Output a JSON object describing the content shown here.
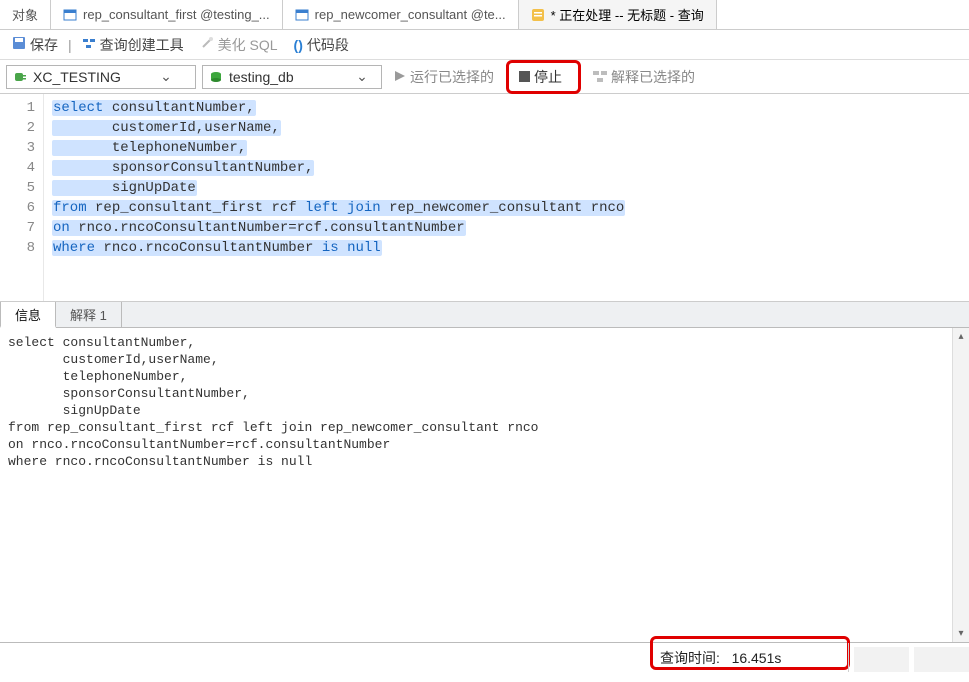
{
  "tabs": [
    {
      "label": "对象",
      "icon": ""
    },
    {
      "label": "rep_consultant_first @testing_...",
      "icon": "table"
    },
    {
      "label": "rep_newcomer_consultant @te...",
      "icon": "table"
    },
    {
      "label": "* 正在处理 -- 无标题 - 查询",
      "icon": "query",
      "active": true
    }
  ],
  "toolbar": {
    "save": "保存",
    "querybuilder": "查询创建工具",
    "beautify": "美化 SQL",
    "snippet": "代码段"
  },
  "controls": {
    "connection": "XC_TESTING",
    "database": "testing_db",
    "run": "运行已选择的",
    "stop": "停止",
    "explain": "解释已选择的"
  },
  "editor_lines": [
    {
      "n": "1",
      "pre": "",
      "kw": "select",
      "post": " consultantNumber,"
    },
    {
      "n": "2",
      "pre": "       ",
      "kw": "",
      "post": "customerId,userName,"
    },
    {
      "n": "3",
      "pre": "       ",
      "kw": "",
      "post": "telephoneNumber,"
    },
    {
      "n": "4",
      "pre": "       ",
      "kw": "",
      "post": "sponsorConsultantNumber,"
    },
    {
      "n": "5",
      "pre": "       ",
      "kw": "",
      "post": "signUpDate"
    },
    {
      "n": "6",
      "pre": "",
      "kw": "from",
      "post": " rep_consultant_first rcf ",
      "kw2": "left join",
      "post2": " rep_newcomer_consultant rnco"
    },
    {
      "n": "7",
      "pre": "",
      "kw": "on",
      "post": " rnco.rncoConsultantNumber=rcf.consultantNumber"
    },
    {
      "n": "8",
      "pre": "",
      "kw": "where",
      "post": " rnco.rncoConsultantNumber ",
      "kw2": "is null",
      "post2": ""
    }
  ],
  "result_tabs": {
    "info": "信息",
    "explain": "解释 1"
  },
  "result_text": "select consultantNumber,\n       customerId,userName,\n       telephoneNumber,\n       sponsorConsultantNumber,\n       signUpDate\nfrom rep_consultant_first rcf left join rep_newcomer_consultant rnco\non rnco.rncoConsultantNumber=rcf.consultantNumber\nwhere rnco.rncoConsultantNumber is null",
  "status": {
    "query_time_label": "查询时间:",
    "query_time_value": "16.451s"
  }
}
